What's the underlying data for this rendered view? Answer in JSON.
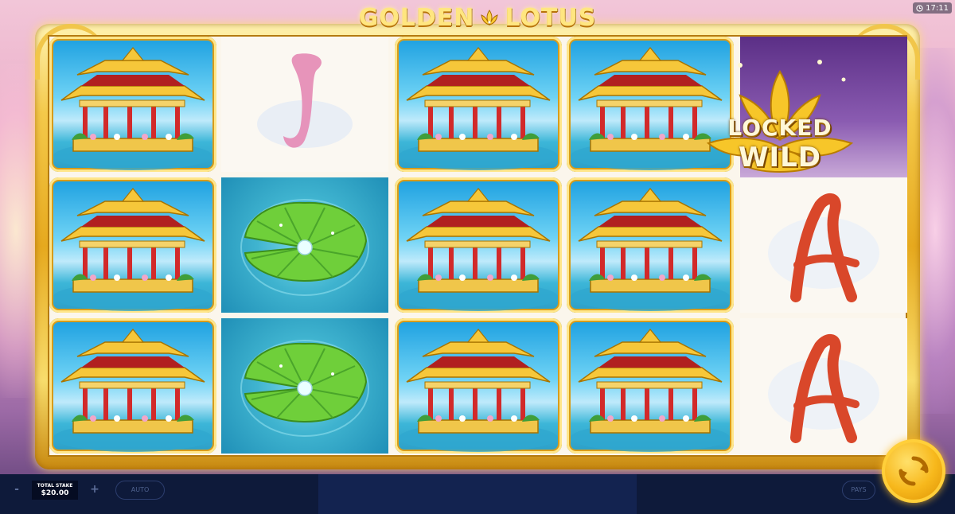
{
  "game": {
    "title_word1": "GOLDEN",
    "title_word2": "LOTUS"
  },
  "status": {
    "clock": "17:11"
  },
  "reels": {
    "columns": [
      [
        "pagoda",
        "pagoda",
        "pagoda"
      ],
      [
        "J",
        "lily-pad",
        "lily-pad"
      ],
      [
        "pagoda",
        "pagoda",
        "pagoda"
      ],
      [
        "pagoda",
        "pagoda",
        "pagoda"
      ],
      [
        "locked-wild",
        "A",
        "A"
      ]
    ],
    "locked_wild_line1": "LOCKED",
    "locked_wild_line2": "WILD",
    "letter_j": "J",
    "letter_a": "A"
  },
  "controls": {
    "minus_label": "-",
    "plus_label": "+",
    "total_stake_label": "TOTAL STAKE",
    "total_stake_value": "$20.00",
    "auto_label": "AUTO",
    "pays_label": "PAYS"
  },
  "colors": {
    "gold": "#f4c94a",
    "bar": "#0e1a3a",
    "letter_j": "#e58bb5",
    "letter_a": "#d9472a"
  }
}
